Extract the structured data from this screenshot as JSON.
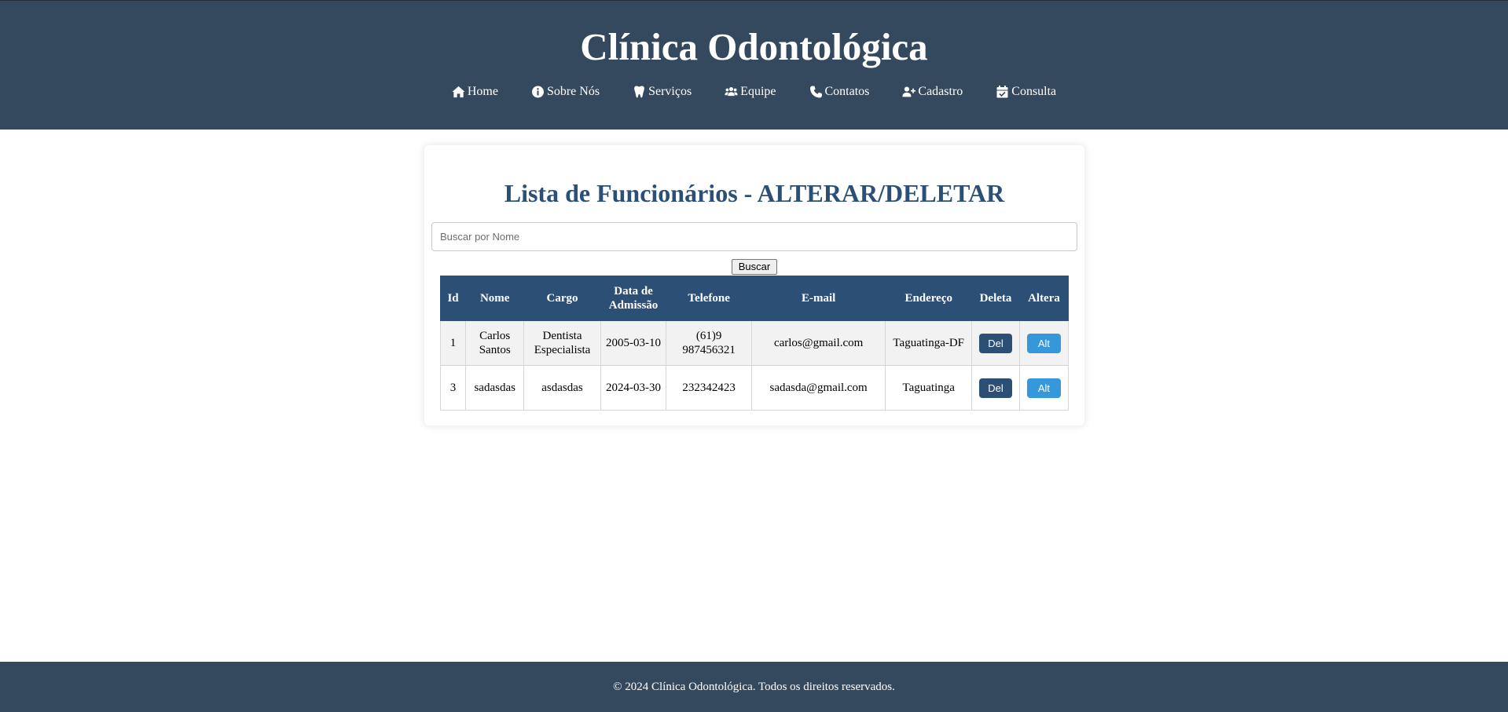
{
  "header": {
    "title": "Clínica Odontológica",
    "background_color": "#34495e",
    "nav": [
      {
        "icon": "home-icon",
        "label": "Home"
      },
      {
        "icon": "info-icon",
        "label": "Sobre Nós"
      },
      {
        "icon": "tooth-icon",
        "label": "Serviços"
      },
      {
        "icon": "users-icon",
        "label": "Equipe"
      },
      {
        "icon": "phone-icon",
        "label": "Contatos"
      },
      {
        "icon": "user-plus-icon",
        "label": "Cadastro"
      },
      {
        "icon": "calendar-check-icon",
        "label": "Consulta"
      }
    ]
  },
  "main": {
    "title": "Lista de Funcionários - ALTERAR/DELETAR",
    "title_color": "#2c4f75",
    "search": {
      "placeholder": "Buscar por Nome",
      "value": "",
      "button_label": "Buscar"
    },
    "table": {
      "header_color": "#2c4f75",
      "columns": [
        "Id",
        "Nome",
        "Cargo",
        "Data de Admissão",
        "Telefone",
        "E-mail",
        "Endereço",
        "Deleta",
        "Altera"
      ],
      "rows": [
        {
          "id": "1",
          "nome": "Carlos Santos",
          "cargo": "Dentista Especialista",
          "data_admissao": "2005-03-10",
          "telefone": "(61)9 987456321",
          "email": "carlos@gmail.com",
          "endereco": "Taguatinga-DF",
          "delete_label": "Del",
          "alter_label": "Alt"
        },
        {
          "id": "3",
          "nome": "sadasdas",
          "cargo": "asdasdas",
          "data_admissao": "2024-03-30",
          "telefone": "232342423",
          "email": "sadasda@gmail.com",
          "endereco": "Taguatinga",
          "delete_label": "Del",
          "alter_label": "Alt"
        }
      ],
      "delete_button_color": "#2c4f75",
      "alter_button_color": "#3498db"
    }
  },
  "footer": {
    "text": "© 2024 Clínica Odontológica. Todos os direitos reservados."
  }
}
